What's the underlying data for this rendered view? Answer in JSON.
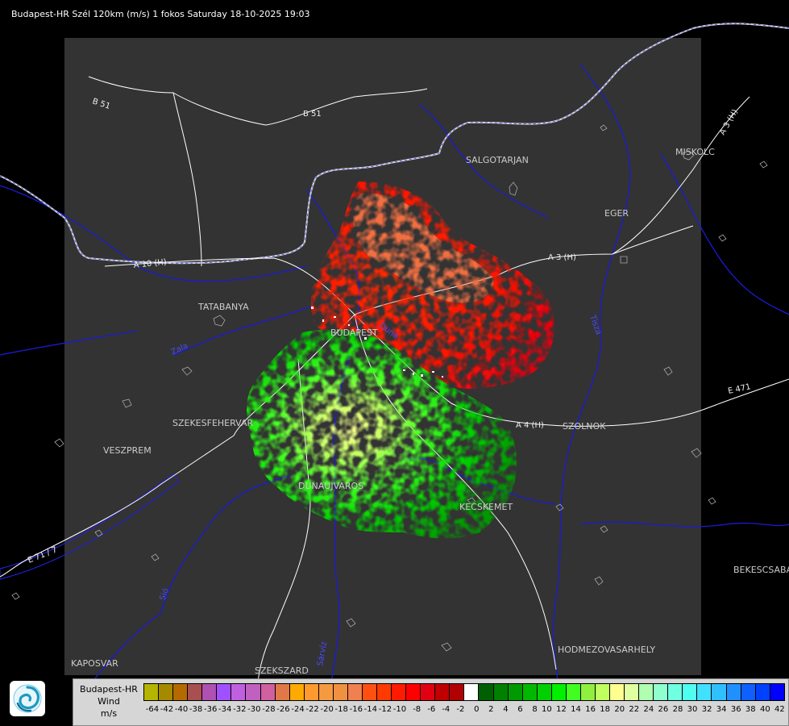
{
  "title": "Budapest-HR Szél 120km (m/s) 1 fokos Saturday 18-10-2025 19:03",
  "colors": {
    "background": "#000000",
    "coverage": "#333333",
    "border": "#cfcfcf",
    "rivers": "#1b1bd6",
    "roads": "#ffffff",
    "contours": "#4a5a9a"
  },
  "legend": {
    "station": "Budapest-HR",
    "quantity": "Wind",
    "unit": "m/s",
    "bins": [
      {
        "label": "-64",
        "color": "#b5b500"
      },
      {
        "label": "-42",
        "color": "#a58a00"
      },
      {
        "label": "-40",
        "color": "#b56a00"
      },
      {
        "label": "-38",
        "color": "#a85050"
      },
      {
        "label": "-36",
        "color": "#b050b0"
      },
      {
        "label": "-34",
        "color": "#a050ff"
      },
      {
        "label": "-32",
        "color": "#c060e0"
      },
      {
        "label": "-30",
        "color": "#c060c0"
      },
      {
        "label": "-28",
        "color": "#d060a0"
      },
      {
        "label": "-26",
        "color": "#e07848"
      },
      {
        "label": "-24",
        "color": "#ffaa00"
      },
      {
        "label": "-22",
        "color": "#ff9a30"
      },
      {
        "label": "-20",
        "color": "#f59a40"
      },
      {
        "label": "-18",
        "color": "#f09040"
      },
      {
        "label": "-16",
        "color": "#f08050"
      },
      {
        "label": "-14",
        "color": "#ff5010"
      },
      {
        "label": "-12",
        "color": "#ff3a00"
      },
      {
        "label": "-10",
        "color": "#ff1a00"
      },
      {
        "label": "-8",
        "color": "#ff0000"
      },
      {
        "label": "-6",
        "color": "#e00010"
      },
      {
        "label": "-4",
        "color": "#c00000"
      },
      {
        "label": "-2",
        "color": "#b00000"
      },
      {
        "label": "0",
        "color": "#ffffff"
      },
      {
        "label": "2",
        "color": "#006000"
      },
      {
        "label": "4",
        "color": "#008000"
      },
      {
        "label": "6",
        "color": "#009a00"
      },
      {
        "label": "8",
        "color": "#00b800"
      },
      {
        "label": "10",
        "color": "#00d000"
      },
      {
        "label": "12",
        "color": "#00f000"
      },
      {
        "label": "14",
        "color": "#40ff20"
      },
      {
        "label": "16",
        "color": "#90f040"
      },
      {
        "label": "18",
        "color": "#c0ff60"
      },
      {
        "label": "20",
        "color": "#ffff90"
      },
      {
        "label": "22",
        "color": "#e0ffa0"
      },
      {
        "label": "24",
        "color": "#b0ffb0"
      },
      {
        "label": "26",
        "color": "#90ffd0"
      },
      {
        "label": "28",
        "color": "#70ffe0"
      },
      {
        "label": "30",
        "color": "#50fff0"
      },
      {
        "label": "32",
        "color": "#40e0ff"
      },
      {
        "label": "34",
        "color": "#30c0ff"
      },
      {
        "label": "36",
        "color": "#2090ff"
      },
      {
        "label": "38",
        "color": "#1060ff"
      },
      {
        "label": "40",
        "color": "#0040ff"
      },
      {
        "label": "42",
        "color": "#0000ff"
      }
    ]
  },
  "places": [
    {
      "name": "SALGOTARJAN"
    },
    {
      "name": "MISKOLC"
    },
    {
      "name": "EGER"
    },
    {
      "name": "TATABANYA"
    },
    {
      "name": "BUDAPEST"
    },
    {
      "name": "SZEKESFEHERVAR"
    },
    {
      "name": "VESZPREM"
    },
    {
      "name": "SZOLNOK"
    },
    {
      "name": "DUNAUJVAROS"
    },
    {
      "name": "KECSKEMET"
    },
    {
      "name": "BEKESCSABA"
    },
    {
      "name": "HODMEZOVASARHELY"
    },
    {
      "name": "KAPOSVAR"
    },
    {
      "name": "SZEKSZARD"
    }
  ],
  "roads": [
    {
      "name": "B 51"
    },
    {
      "name": "B 51"
    },
    {
      "name": "A 10 (H)"
    },
    {
      "name": "A 3 (H)"
    },
    {
      "name": "A 3 (H)"
    },
    {
      "name": "A 4 (H)"
    },
    {
      "name": "E 471"
    },
    {
      "name": "E 71 / 7"
    }
  ],
  "rivers": [
    {
      "name": "Duna"
    },
    {
      "name": "Tisza"
    },
    {
      "name": "Sió"
    },
    {
      "name": "Zala"
    },
    {
      "name": "Sárvíz"
    }
  ]
}
